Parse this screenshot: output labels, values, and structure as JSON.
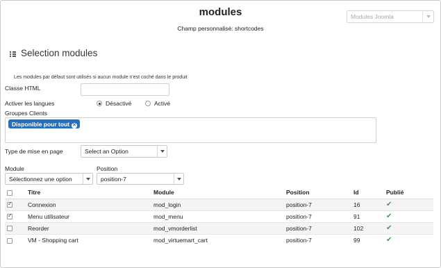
{
  "header": {
    "title": "modules",
    "subtitle": "Champ personnalisé: shortcodes",
    "type_select": "Modules Joomla"
  },
  "section": {
    "title": "Selection modules",
    "note": "Les modules par défaut sont utilisés si aucun module n'est coché dans le produit"
  },
  "form": {
    "classe_html_label": "Classe HTML",
    "classe_html_value": "",
    "langues_label": "Activer les langues",
    "langues_options": [
      "Désactivé",
      "Activé"
    ],
    "langues_selected": "Désactivé",
    "groupes_label": "Groupes Clients",
    "groupes_chip": "Disponible pour tout",
    "type_page_label": "Type de mise en page",
    "type_page_value": "Select an Option",
    "module_label": "Module",
    "module_value": "Sélectionnez une option",
    "position_label": "Position",
    "position_value": "position-7"
  },
  "table": {
    "headers": [
      "Titre",
      "Module",
      "Position",
      "Id",
      "Publié"
    ],
    "rows": [
      {
        "checked": true,
        "titre": "Connexion",
        "module": "mod_login",
        "position": "position-7",
        "id": "16",
        "published": true
      },
      {
        "checked": true,
        "titre": "Menu utilisateur",
        "module": "mod_menu",
        "position": "position-7",
        "id": "91",
        "published": true
      },
      {
        "checked": false,
        "titre": "Reorder",
        "module": "mod_vmorderlist",
        "position": "position-7",
        "id": "102",
        "published": true
      },
      {
        "checked": false,
        "titre": "VM - Shopping cart",
        "module": "mod_virtuemart_cart",
        "position": "position-7",
        "id": "99",
        "published": true
      }
    ]
  },
  "colors": {
    "accent": "#2a6eb5",
    "published": "#3c9b3a"
  }
}
